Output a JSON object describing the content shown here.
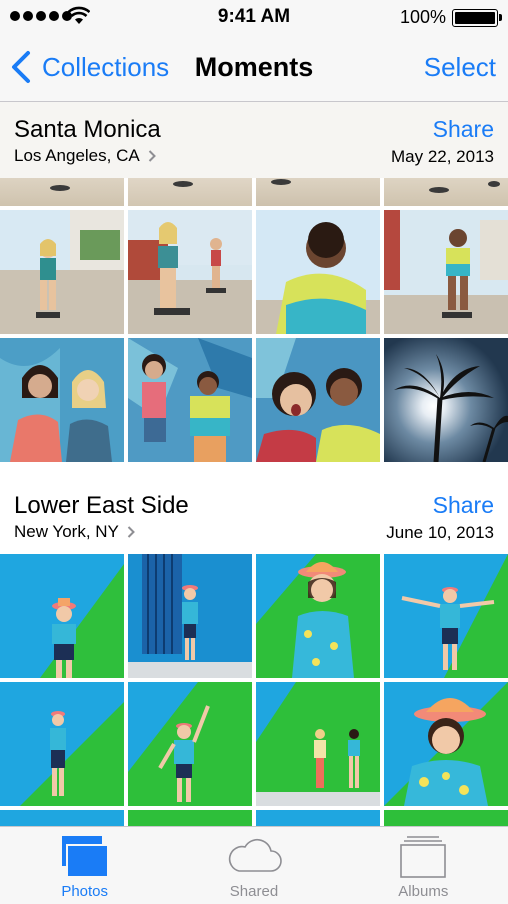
{
  "status": {
    "time": "9:41 AM",
    "battery": "100%"
  },
  "nav": {
    "back_label": "Collections",
    "title": "Moments",
    "select_label": "Select"
  },
  "sections": [
    {
      "title": "Santa Monica",
      "location": "Los Angeles, CA",
      "share_label": "Share",
      "date": "May 22, 2013"
    },
    {
      "title": "Lower East Side",
      "location": "New York, NY",
      "share_label": "Share",
      "date": "June 10, 2013"
    }
  ],
  "tabs": [
    {
      "label": "Photos",
      "icon": "photos-icon",
      "active": true
    },
    {
      "label": "Shared",
      "icon": "cloud-icon",
      "active": false
    },
    {
      "label": "Albums",
      "icon": "albums-icon",
      "active": false
    }
  ],
  "colors": {
    "accent": "#1a7cf6",
    "inactive": "#8e8e93"
  }
}
